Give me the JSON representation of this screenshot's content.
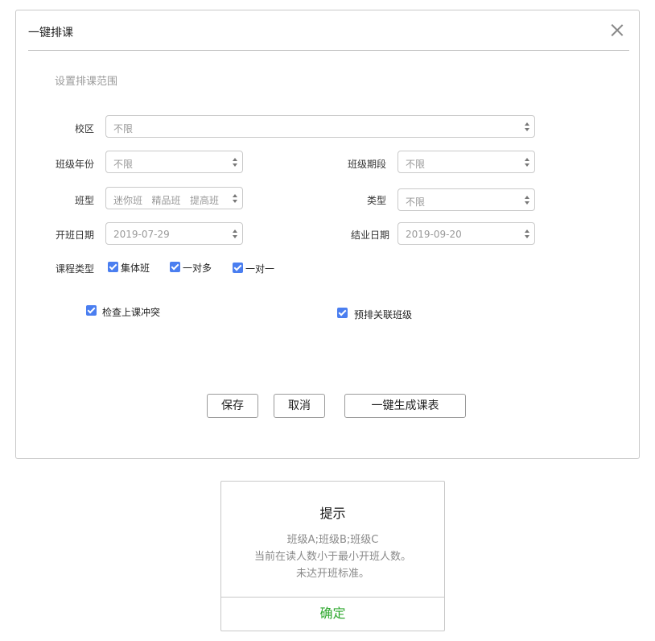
{
  "dialog": {
    "title": "一键排课",
    "section_title": "设置排课范围",
    "fields": {
      "campus": {
        "label": "校区",
        "value": "不限"
      },
      "class_year": {
        "label": "班级年份",
        "value": "不限"
      },
      "class_period": {
        "label": "班级期段",
        "value": "不限"
      },
      "class_type": {
        "label": "班型",
        "values": [
          "迷你班",
          "精品班",
          "提高班"
        ]
      },
      "category": {
        "label": "类型",
        "value": "不限"
      },
      "start_date": {
        "label": "开班日期",
        "value": "2019-07-29"
      },
      "end_date": {
        "label": "结业日期",
        "value": "2019-09-20"
      }
    },
    "course_type": {
      "label": "课程类型",
      "options": [
        {
          "label": "集体班",
          "checked": true
        },
        {
          "label": "一对多",
          "checked": true
        },
        {
          "label": "一对一",
          "checked": true
        }
      ]
    },
    "check_conflict": {
      "label": "检查上课冲突",
      "checked": true
    },
    "pre_link_class": {
      "label": "预排关联班级",
      "checked": true
    },
    "buttons": {
      "save": "保存",
      "cancel": "取消",
      "generate": "一键生成课表"
    }
  },
  "modal": {
    "title": "提示",
    "lines": [
      "班级A;班级B;班级C",
      "当前在读人数小于最小开班人数。",
      "未达开班标准。"
    ],
    "ok": "确定"
  },
  "colors": {
    "accent": "#4a7ef0",
    "ok_green": "#2fa82f"
  }
}
